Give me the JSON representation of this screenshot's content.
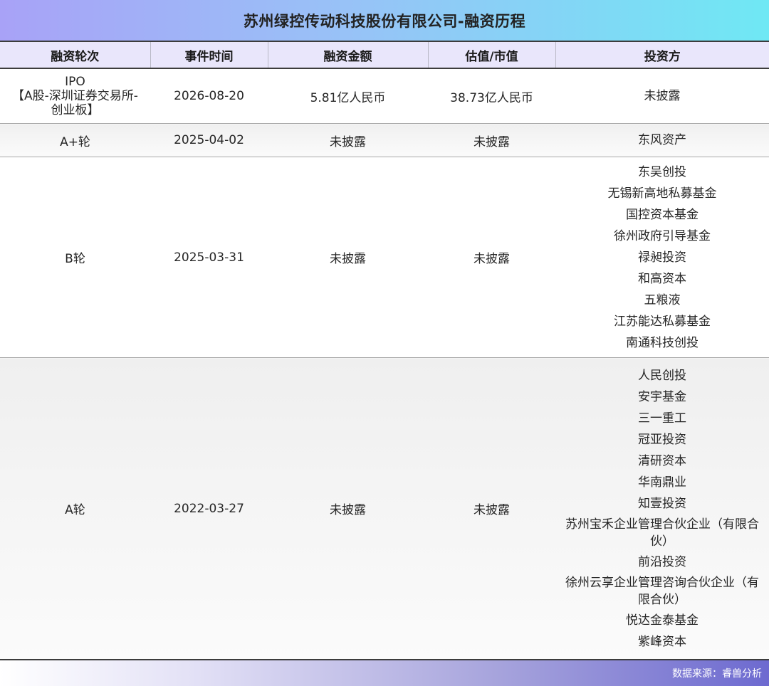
{
  "title": "苏州绿控传动科技股份有限公司-融资历程",
  "columns": [
    "融资轮次",
    "事件时间",
    "融资金额",
    "估值/市值",
    "投资方"
  ],
  "rows": [
    {
      "round": "IPO\n【A股-深圳证券交易所-创业板】",
      "date": "2026-08-20",
      "amount": "5.81亿人民币",
      "valuation": "38.73亿人民币",
      "investors": [
        "未披露"
      ]
    },
    {
      "round": "A+轮",
      "date": "2025-04-02",
      "amount": "未披露",
      "valuation": "未披露",
      "investors": [
        "东风资产"
      ]
    },
    {
      "round": "B轮",
      "date": "2025-03-31",
      "amount": "未披露",
      "valuation": "未披露",
      "investors": [
        "东吴创投",
        "无锡新高地私募基金",
        "国控资本基金",
        "徐州政府引导基金",
        "禄昶投资",
        "和高资本",
        "五粮液",
        "江苏能达私募基金",
        "南通科技创投"
      ]
    },
    {
      "round": "A轮",
      "date": "2022-03-27",
      "amount": "未披露",
      "valuation": "未披露",
      "investors": [
        "人民创投",
        "安宇基金",
        "三一重工",
        "冠亚投资",
        "清研资本",
        "华南鼎业",
        "知壹投资",
        "苏州宝禾企业管理合伙企业（有限合伙）",
        "前沿投资",
        "徐州云享企业管理咨询合伙企业（有限合伙）",
        "悦达金泰基金",
        "紫峰资本"
      ]
    }
  ],
  "footer": "数据来源：睿兽分析"
}
